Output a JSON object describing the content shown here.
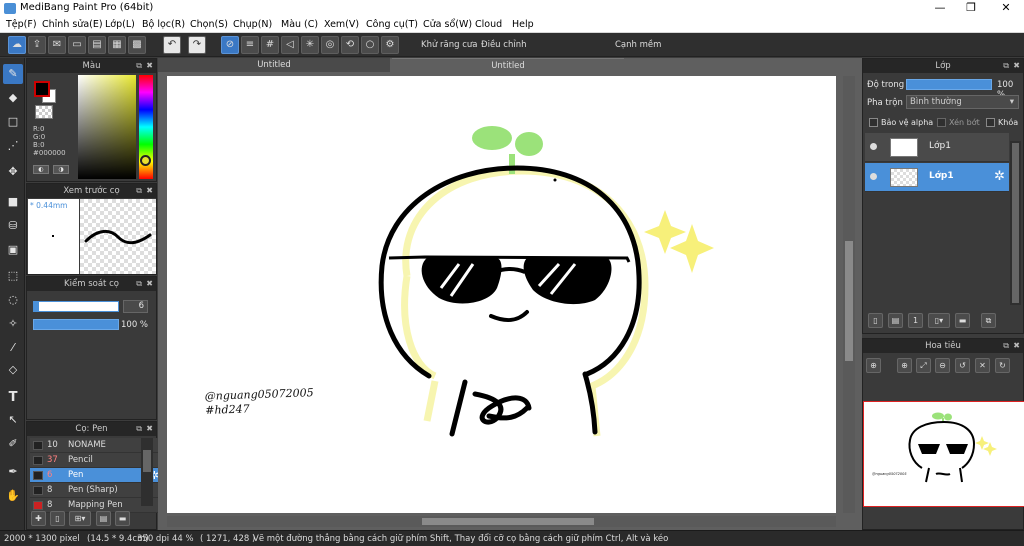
{
  "window": {
    "title": "MediBang Paint Pro (64bit)",
    "minimize": "—",
    "restore": "❐",
    "close": "✕"
  },
  "menu": [
    "Tệp(F)",
    "Chỉnh sửa(E)",
    "Lớp(L)",
    "Bộ lọc(R)",
    "Chọn(S)",
    "Chụp(N)",
    "Màu (C)",
    "Xem(V)",
    "Công cụ(T)",
    "Cửa sổ(W)",
    "Cloud",
    "Help"
  ],
  "toolbar": {
    "antialias_label": "Khử răng cưa",
    "antialias_checked": true,
    "correction_label": "Điều chỉnh",
    "correction_value": "20",
    "edge_label": "Cạnh mềm",
    "edge_checked": false
  },
  "tabs": [
    "Untitled",
    "Untitled"
  ],
  "color_panel": {
    "title": "Màu",
    "fg_color": "#000000",
    "bg_color": "#ffffff",
    "r": "R:0",
    "g": "G:0",
    "b": "B:0",
    "hex": "#000000"
  },
  "preview_panel": {
    "title": "Xem trước cọ",
    "size": "0.44mm"
  },
  "brush_control": {
    "title": "Kiểm soát cọ",
    "size_value": "6",
    "opacity_value": "100 %"
  },
  "brush_panel": {
    "title": "Cọ: Pen",
    "items": [
      {
        "size": "10",
        "name": "NONAME",
        "color": "#222222",
        "selected": false
      },
      {
        "size": "37",
        "name": "Pencil",
        "color": "#222222",
        "selected": false
      },
      {
        "size": "6",
        "name": "Pen",
        "color": "#222222",
        "selected": true
      },
      {
        "size": "8",
        "name": "Pen (Sharp)",
        "color": "#222222",
        "selected": false
      },
      {
        "size": "8",
        "name": "Mapping Pen",
        "color": "#cc2222",
        "selected": false
      }
    ]
  },
  "layer_panel": {
    "title": "Lớp",
    "opacity_label": "Độ trong",
    "opacity_value": "100 %",
    "blend_label": "Pha trộn",
    "blend_value": "Bình thường",
    "protect_alpha": "Bảo vệ alpha",
    "clipping": "Xén bớt",
    "lock": "Khóa",
    "layers": [
      {
        "name": "Lớp1",
        "selected": false
      },
      {
        "name": "Lớp1",
        "selected": true
      }
    ]
  },
  "navigator_panel": {
    "title": "Hoa tiêu"
  },
  "artwork": {
    "signature_line1": "@nguang05072005",
    "signature_line2": "#hd247",
    "thumb_signature": "@nguang05072005"
  },
  "status": {
    "size": "2000 * 1300 pixel",
    "dimensions": "(14.5 * 9.4cm)",
    "dpi": "350 dpi",
    "zoom": "44 %",
    "coords": "( 1271, 428 )",
    "hint": "Vẽ một đường thẳng bằng cách giữ phím Shift, Thay đổi cỡ cọ bằng cách giữ phím Ctrl, Alt và kéo"
  },
  "colors": {
    "accent": "#4a90d9",
    "panel": "#3a3a3a",
    "sprout": "#9be27a",
    "sparkle": "#f7f07a"
  }
}
